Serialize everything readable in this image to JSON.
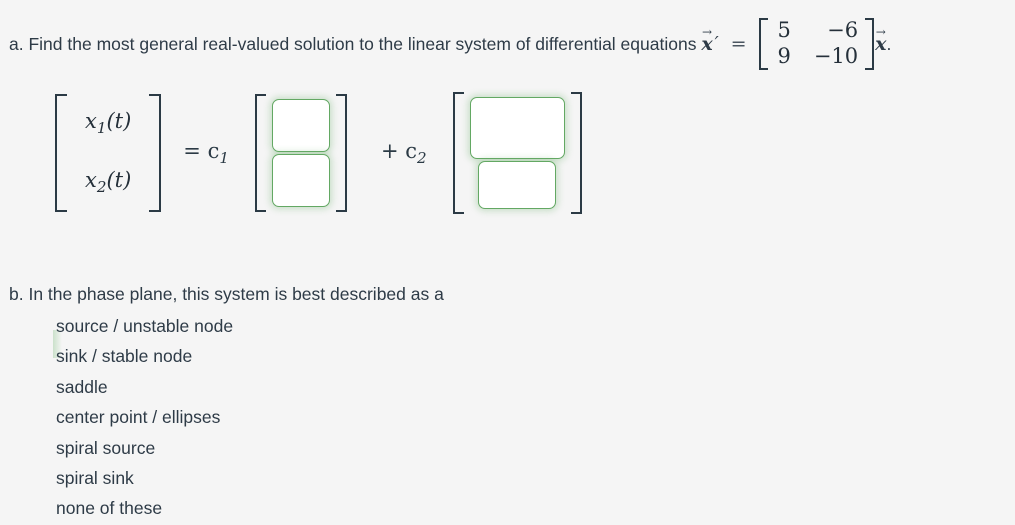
{
  "page": {
    "background_color": "#f5f5f5",
    "text_color": "#2e3b47",
    "accent_color": "#63a863"
  },
  "part_a": {
    "label": "a.",
    "text_before": "Find the most general real-valued solution to the linear system of differential equations",
    "vector_symbol": "x",
    "vector_arrow": "→",
    "prime": "′",
    "equals": "=",
    "trailing": ".",
    "matrix": {
      "rows": [
        [
          "5",
          "−6"
        ],
        [
          "9",
          "−10"
        ]
      ]
    },
    "solution": {
      "lhs": {
        "row1_base": "x",
        "row1_sub": "1",
        "row1_arg": "(t)",
        "row2_base": "x",
        "row2_sub": "2",
        "row2_arg": "(t)"
      },
      "equals_c1": "= c",
      "c1_sub": "1",
      "plus_c2": "+ c",
      "c2_sub": "2",
      "group1": {
        "box_top_value": "",
        "box_top_placeholder": "",
        "box_bottom_value": "",
        "box_bottom_placeholder": ""
      },
      "group2": {
        "box_top_value": "",
        "box_top_placeholder": "",
        "box_bottom_value": "",
        "box_bottom_placeholder": ""
      }
    }
  },
  "part_b": {
    "label": "b.",
    "question": "b. In the phase plane, this system is best described as a",
    "options": [
      "source / unstable node",
      "sink / stable node",
      "saddle",
      "center point / ellipses",
      "spiral source",
      "spiral sink",
      "none of these"
    ]
  }
}
